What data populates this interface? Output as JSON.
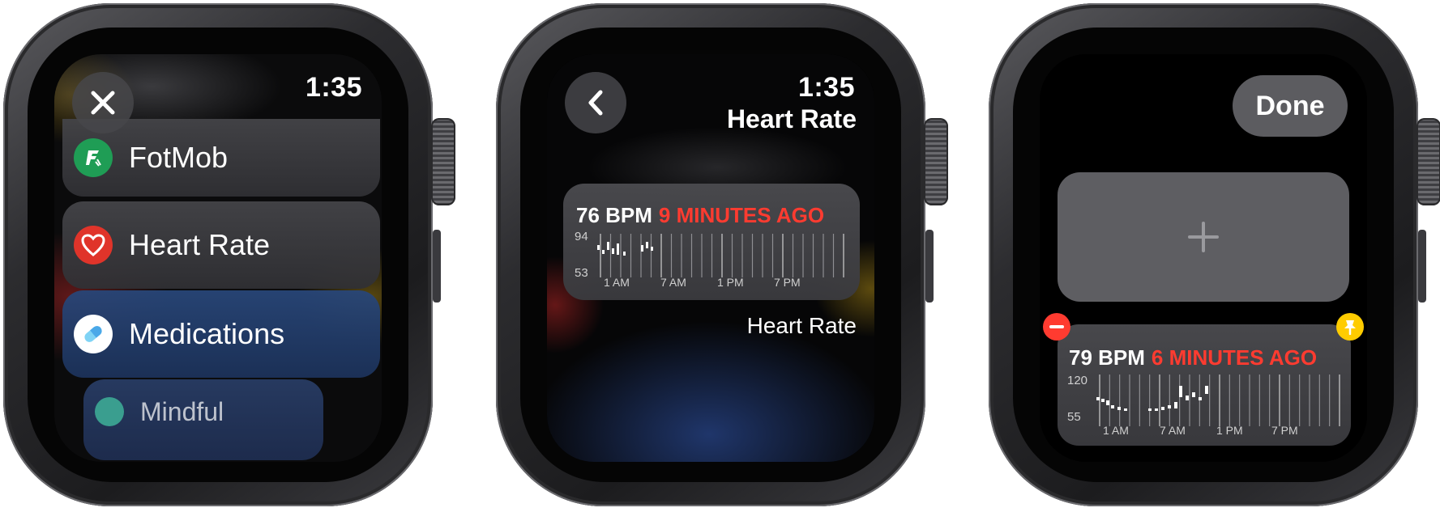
{
  "watch1": {
    "time": "1:35",
    "close_icon": "close-icon",
    "items": [
      {
        "label": "FotMob",
        "icon": "fotmob-icon",
        "color": "#1f9d55"
      },
      {
        "label": "Heart Rate",
        "icon": "heart-icon",
        "color": "#e0342a"
      },
      {
        "label": "Medications",
        "icon": "pill-icon",
        "color": "#ffffff"
      },
      {
        "label": "Mindful",
        "icon": "mindfulness-icon",
        "color": "#3a9e8f"
      }
    ]
  },
  "watch2": {
    "time": "1:35",
    "back_icon": "chevron-left-icon",
    "title": "Heart Rate",
    "widget": {
      "bpm": "76 BPM",
      "ago": "9 MINUTES AGO",
      "y_high": "94",
      "y_low": "53",
      "x_ticks": [
        "1 AM",
        "7 AM",
        "1 PM",
        "7 PM"
      ]
    },
    "caption": "Heart Rate"
  },
  "watch3": {
    "done_label": "Done",
    "add_icon": "plus-icon",
    "remove_icon": "minus-icon",
    "pin_icon": "pin-icon",
    "widget": {
      "bpm": "79 BPM",
      "ago": "6 MINUTES AGO",
      "y_high": "120",
      "y_low": "55",
      "x_ticks": [
        "1 AM",
        "7 AM",
        "1 PM",
        "7 PM"
      ]
    }
  },
  "colors": {
    "accent_red": "#ff3b30",
    "pin_yellow": "#ffcc00",
    "remove_red": "#ff3b30"
  }
}
